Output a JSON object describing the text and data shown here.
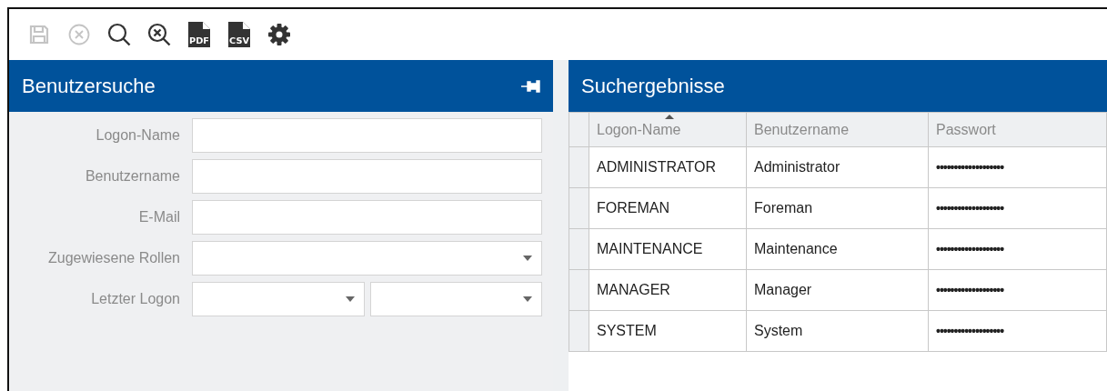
{
  "toolbar": [
    {
      "kind": "save",
      "disabled": true
    },
    {
      "kind": "cancel",
      "disabled": true
    },
    {
      "kind": "search",
      "disabled": false
    },
    {
      "kind": "clear-search",
      "disabled": false
    },
    {
      "kind": "file",
      "label": "PDF",
      "disabled": false
    },
    {
      "kind": "file",
      "label": "CSV",
      "disabled": false
    },
    {
      "kind": "settings",
      "disabled": false
    }
  ],
  "search_panel": {
    "title": "Benutzersuche",
    "pinned": true,
    "fields": [
      {
        "label": "Logon-Name",
        "kind": "text"
      },
      {
        "label": "Benutzername",
        "kind": "text"
      },
      {
        "label": "E-Mail",
        "kind": "text"
      },
      {
        "label": "Zugewiesene Rollen",
        "kind": "dropdown"
      },
      {
        "label": "Letzter Logon",
        "kind": "dropdown-pair"
      }
    ]
  },
  "results_panel": {
    "title": "Suchergebnisse",
    "table": {
      "columns": [
        {
          "label": "Logon-Name",
          "sorted": true
        },
        {
          "label": "Benutzername",
          "sorted": false
        },
        {
          "label": "Passwort",
          "sorted": false
        }
      ],
      "rows": [
        [
          "ADMINISTRATOR",
          "Administrator",
          "•••••••••••••••••••"
        ],
        [
          "FOREMAN",
          "Foreman",
          "•••••••••••••••••••"
        ],
        [
          "MAINTENANCE",
          "Maintenance",
          "•••••••••••••••••••"
        ],
        [
          "MANAGER",
          "Manager",
          "•••••••••••••••••••"
        ],
        [
          "SYSTEM",
          "System",
          "•••••••••••••••••••"
        ]
      ]
    }
  }
}
